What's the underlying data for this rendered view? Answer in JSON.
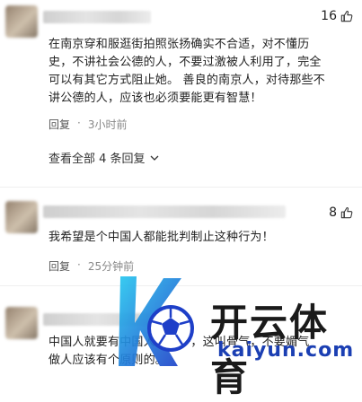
{
  "comments": [
    {
      "likes": "16",
      "body_lines": [
        "在南京穿和服逛街拍照张扬确实不合适，对不懂历",
        "史，不讲社会公德的人，不要过激被人利用了，完全",
        "可以有其它方式阻止她。 善良的南京人，对待那些不",
        "讲公德的人，应该也必须要能更有智慧！"
      ],
      "reply_label": "回复",
      "time": "3小时前",
      "view_all": "查看全部 4 条回复"
    },
    {
      "likes": "8",
      "body_lines": [
        "我希望是个中国人都能批判制止这种行为！"
      ],
      "reply_label": "回复",
      "time": "25分钟前"
    },
    {
      "body_lines": [
        "中国人就要有中国人的样子，这叫骨气，不要媚气",
        "做人应该有个原则的。"
      ]
    }
  ],
  "watermark": {
    "cn": "开云体育",
    "en": "kaiyun.com"
  },
  "icons": {
    "like": "thumbs-up-icon",
    "chevron": "chevron-down-icon"
  },
  "colors": {
    "meta_gray": "#888888",
    "watermark_blue": "#1b3fb3"
  }
}
